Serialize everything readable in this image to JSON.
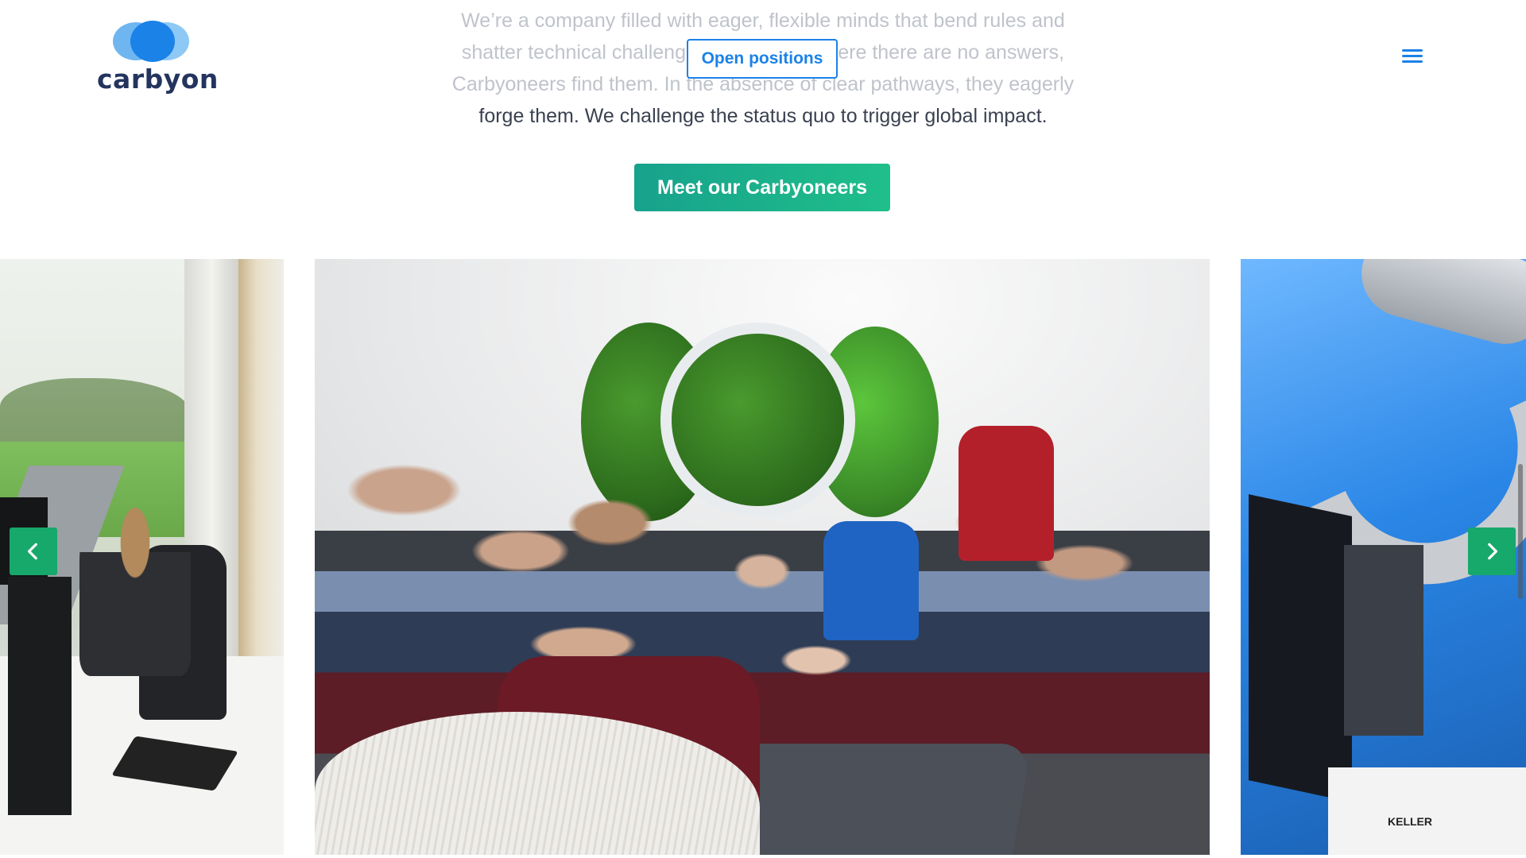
{
  "brand": {
    "logo_text": "carbyon",
    "colors": {
      "primary": "#1b82e8",
      "accent": "#17a86b",
      "navy": "#23345e"
    }
  },
  "header": {
    "menu_icon": "hamburger-menu-icon"
  },
  "intro": {
    "line1": "We’re a company filled with eager, flexible minds that bend rules and",
    "line2": "shatter technical challenges every day. Where there are no answers,",
    "line3": "Carbyoneers find them. In the absence of clear pathways, they eagerly",
    "line4": "forge them. We challenge the status quo to trigger global impact."
  },
  "buttons": {
    "open_positions": "Open positions",
    "meet_carbyoneers": "Meet our Carbyoneers"
  },
  "carousel": {
    "prev_icon": "chevron-left-icon",
    "next_icon": "chevron-right-icon",
    "slides": [
      {
        "name": "office-workspace"
      },
      {
        "name": "team-meeting"
      },
      {
        "name": "lab-equipment",
        "label": "KELLER"
      }
    ]
  }
}
